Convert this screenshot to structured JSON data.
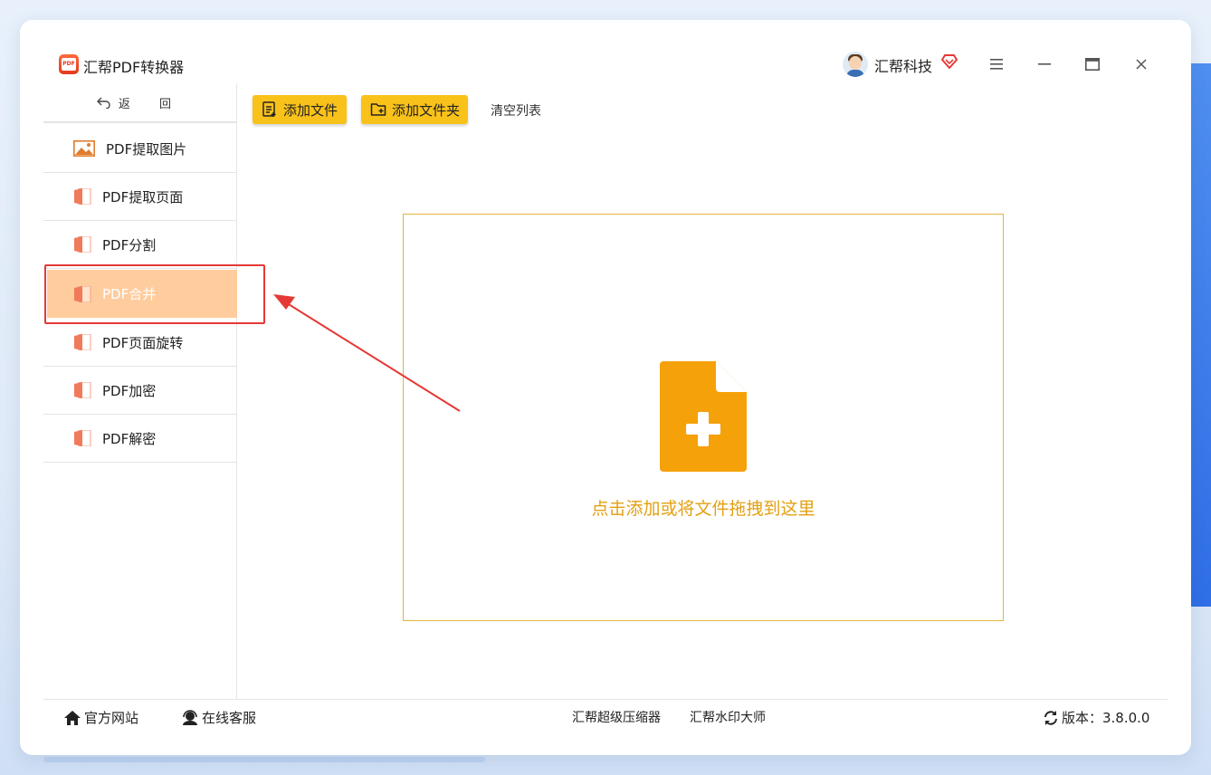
{
  "app": {
    "title": "汇帮PDF转换器",
    "logo_text": "PDF",
    "user_name": "汇帮科技"
  },
  "window_controls": [
    "menu-icon",
    "minimize-icon",
    "maximize-icon",
    "close-icon"
  ],
  "sidebar": {
    "back_label": "返 回",
    "items": [
      {
        "label": "PDF提取图片",
        "icon": "image-icon"
      },
      {
        "label": "PDF提取页面",
        "icon": "pdf-file-icon"
      },
      {
        "label": "PDF分割",
        "icon": "pdf-file-icon"
      },
      {
        "label": "PDF合并",
        "icon": "pdf-file-icon",
        "active": true
      },
      {
        "label": "PDF页面旋转",
        "icon": "pdf-file-icon"
      },
      {
        "label": "PDF加密",
        "icon": "pdf-file-icon"
      },
      {
        "label": "PDF解密",
        "icon": "pdf-file-icon"
      }
    ]
  },
  "toolbar": {
    "add_file": "添加文件",
    "add_folder": "添加文件夹",
    "clear_list": "清空列表"
  },
  "dropzone": {
    "text": "点击添加或将文件拖拽到这里"
  },
  "footer": {
    "website": "官方网站",
    "service": "在线客服",
    "compressor": "汇帮超级压缩器",
    "watermark": "汇帮水印大师",
    "version": "版本：3.8.0.0"
  },
  "colors": {
    "accent_yellow": "#f9c21a",
    "active_item": "#ffcc9e",
    "drop_text": "#e3a012",
    "annotation_red": "#e53935"
  }
}
